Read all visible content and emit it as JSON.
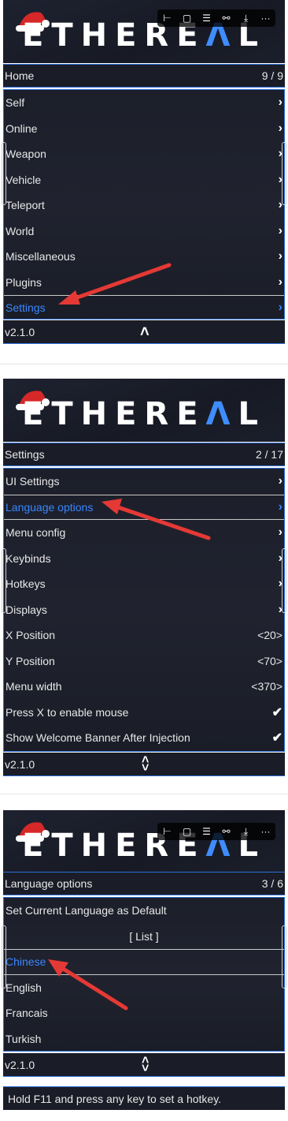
{
  "brand": {
    "logo_text_a": "ETHERE",
    "logo_text_b": "Λ",
    "logo_text_c": "L"
  },
  "toolbar_icons": [
    "align-icon",
    "comment-icon",
    "stack-icon",
    "link-icon",
    "download-icon",
    "more-icon"
  ],
  "toolbar_glyphs": {
    "align": "⊢",
    "comment": "▢",
    "stack": "☰",
    "link": "⚯",
    "download": "⤓",
    "more": "···"
  },
  "panel1": {
    "header": {
      "title": "Home",
      "counter": "9 / 9"
    },
    "items": [
      {
        "label": "Self",
        "value": "›"
      },
      {
        "label": "Online",
        "value": "›"
      },
      {
        "label": "Weapon",
        "value": "›"
      },
      {
        "label": "Vehicle",
        "value": "›"
      },
      {
        "label": "Teleport",
        "value": "›"
      },
      {
        "label": "World",
        "value": "›"
      },
      {
        "label": "Miscellaneous",
        "value": "›"
      },
      {
        "label": "Plugins",
        "value": "›"
      },
      {
        "label": "Settings",
        "value": "›"
      }
    ],
    "footer": {
      "version": "v2.1.0",
      "arrows": "˄"
    }
  },
  "panel2": {
    "header": {
      "title": "Settings",
      "counter": "2 / 17"
    },
    "items": [
      {
        "label": "UI Settings",
        "value": "›"
      },
      {
        "label": "Language options",
        "value": "›"
      },
      {
        "label": "Menu config",
        "value": "›"
      },
      {
        "label": "Keybinds",
        "value": "›"
      },
      {
        "label": "Hotkeys",
        "value": "›"
      },
      {
        "label": "Displays",
        "value": "›"
      },
      {
        "label": "X Position",
        "value": "<20>"
      },
      {
        "label": "Y Position",
        "value": "<70>"
      },
      {
        "label": "Menu width",
        "value": "<370>"
      },
      {
        "label": "Press X to enable mouse",
        "value": "✔"
      },
      {
        "label": "Show Welcome Banner After Injection",
        "value": "✔"
      }
    ],
    "footer": {
      "version": "v2.1.0",
      "arrow_up": "˄",
      "arrow_down": "˅"
    }
  },
  "panel3": {
    "header": {
      "title": "Language options",
      "counter": "3 / 6"
    },
    "items": [
      {
        "label": "Set Current Language as Default",
        "value": ""
      },
      {
        "label": "[ List ]",
        "value": ""
      },
      {
        "label": "Chinese",
        "value": ""
      },
      {
        "label": "English",
        "value": ""
      },
      {
        "label": "Francais",
        "value": ""
      },
      {
        "label": "Turkish",
        "value": ""
      }
    ],
    "footer": {
      "version": "v2.1.0",
      "arrow_up": "˄",
      "arrow_down": "˅"
    },
    "hint": "Hold F11 and press any key to set a hotkey."
  },
  "colors": {
    "accent": "#3a86ff",
    "arrow": "#e53935",
    "bg": "#1a1d27"
  }
}
